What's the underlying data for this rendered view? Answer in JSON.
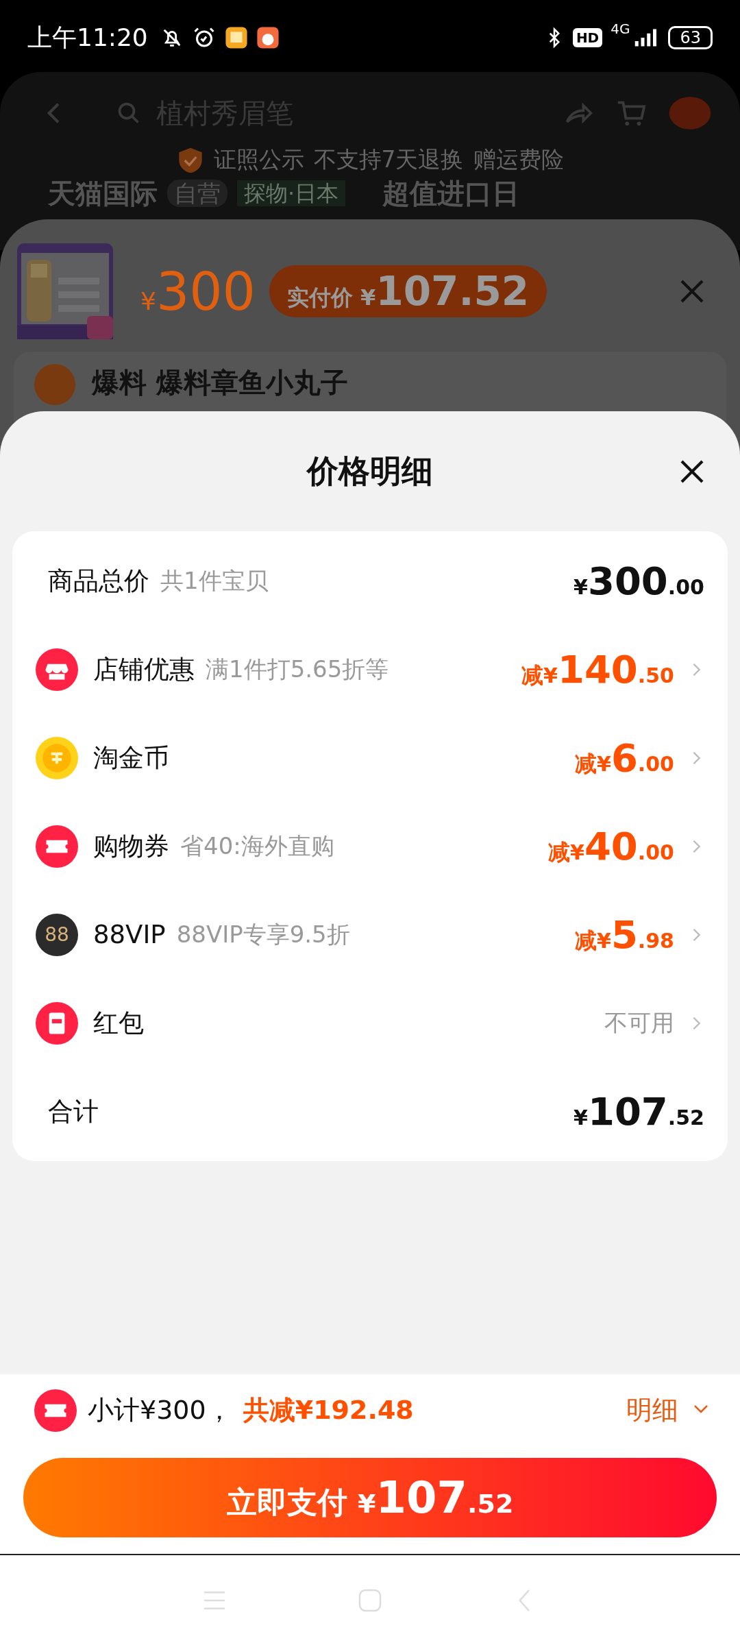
{
  "status_bar": {
    "time": "上午11:20",
    "hd": "HD",
    "network": "4G",
    "battery": "63"
  },
  "background_page": {
    "search": {
      "placeholder": "植村秀眉笔"
    },
    "badges": [
      "证照公示",
      "不支持7天退换",
      "赠运费险"
    ],
    "banner": [
      "天猫国际",
      "自营",
      "探物·日本",
      "超值进口日"
    ]
  },
  "product_sheet": {
    "price": {
      "currency": "¥",
      "amount": "300"
    },
    "pay_pill": {
      "label": "实付价",
      "currency": "¥",
      "amount": "107.52"
    },
    "item_title": "爆料 爆料章鱼小丸子"
  },
  "detail_sheet": {
    "title": "价格明细",
    "rows": [
      {
        "kind": "total",
        "label": "商品总价",
        "note": "共1件宝贝",
        "amount": {
          "currency": "¥",
          "integer": "300",
          "decimal": ".00"
        }
      },
      {
        "kind": "discount",
        "label": "店铺优惠",
        "note": "满1件打5.65折等",
        "amount": {
          "prefix": "减",
          "currency": "¥",
          "integer": "140",
          "decimal": ".50"
        }
      },
      {
        "kind": "discount",
        "label": "淘金币",
        "amount": {
          "prefix": "减",
          "currency": "¥",
          "integer": "6",
          "decimal": ".00"
        }
      },
      {
        "kind": "discount",
        "label": "购物券",
        "note": "省40:海外直购",
        "amount": {
          "prefix": "减",
          "currency": "¥",
          "integer": "40",
          "decimal": ".00"
        }
      },
      {
        "kind": "discount",
        "badge": "88",
        "label": "88VIP",
        "note": "88VIP专享9.5折",
        "amount": {
          "prefix": "减",
          "currency": "¥",
          "integer": "5",
          "decimal": ".98"
        }
      },
      {
        "kind": "status",
        "label": "红包",
        "status": "不可用"
      },
      {
        "kind": "total",
        "label": "合计",
        "amount": {
          "currency": "¥",
          "integer": "107",
          "decimal": ".52"
        }
      }
    ]
  },
  "footer": {
    "subtotal": "小计¥300，",
    "saved": "共减¥192.48",
    "details_link": "明细",
    "pay_button": {
      "label": "立即支付",
      "currency": "¥",
      "integer": "107",
      "decimal": ".52"
    }
  }
}
